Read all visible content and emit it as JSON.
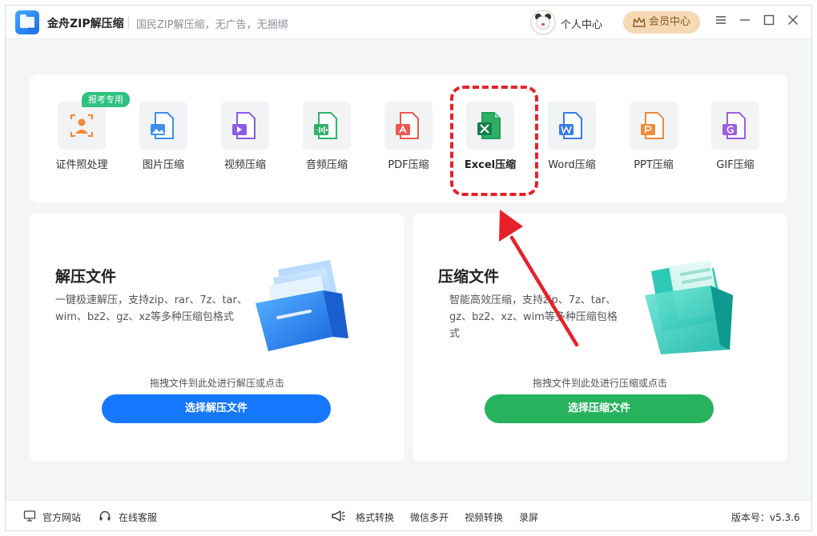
{
  "app": {
    "title": "金舟ZIP解压缩",
    "slogan": "国民ZIP解压缩，无广告，无捆绑",
    "personal_center": "个人中心",
    "vip_center": "会员中心"
  },
  "tools": {
    "tag": "报考专用",
    "items": [
      {
        "label": "证件照处理",
        "icon": "id-photo-icon",
        "color": "#f08a3c",
        "letter": ""
      },
      {
        "label": "图片压缩",
        "icon": "image-icon",
        "color": "#3d8ff0",
        "letter": ""
      },
      {
        "label": "视频压缩",
        "icon": "video-icon",
        "color": "#8a5ce6",
        "letter": ""
      },
      {
        "label": "音频压缩",
        "icon": "audio-icon",
        "color": "#2fb36b",
        "letter": ""
      },
      {
        "label": "PDF压缩",
        "icon": "pdf-icon",
        "color": "#ec5a4d",
        "letter": ""
      },
      {
        "label": "Excel压缩",
        "icon": "excel-icon",
        "color": "#1f9e5a",
        "letter": "X"
      },
      {
        "label": "Word压缩",
        "icon": "word-icon",
        "color": "#3a7bea",
        "letter": "W"
      },
      {
        "label": "PPT压缩",
        "icon": "ppt-icon",
        "color": "#f08a3c",
        "letter": "P"
      },
      {
        "label": "GIF压缩",
        "icon": "gif-icon",
        "color": "#9b5fe0",
        "letter": "G"
      }
    ]
  },
  "extract": {
    "title": "解压文件",
    "desc": "一键极速解压，支持zip、rar、7z、tar、wim、bz2、gz、xz等多种压缩包格式",
    "hint": "拖拽文件到此处进行解压或点击",
    "button": "选择解压文件",
    "color": "#1677ff"
  },
  "compress": {
    "title": "压缩文件",
    "desc": "智能高效压缩，支持zip、7z、tar、gz、bz2、xz、wim等多种压缩包格式",
    "hint": "拖拽文件到此处进行压缩或点击",
    "button": "选择压缩文件",
    "color": "#27b35d"
  },
  "footer": {
    "website": "官方网站",
    "support": "在线客服",
    "format_convert": "格式转换",
    "wechat_multi": "微信多开",
    "video_convert": "视频转换",
    "record": "录屏",
    "version": "版本号：v5.3.6"
  },
  "accent": "#e8202a"
}
